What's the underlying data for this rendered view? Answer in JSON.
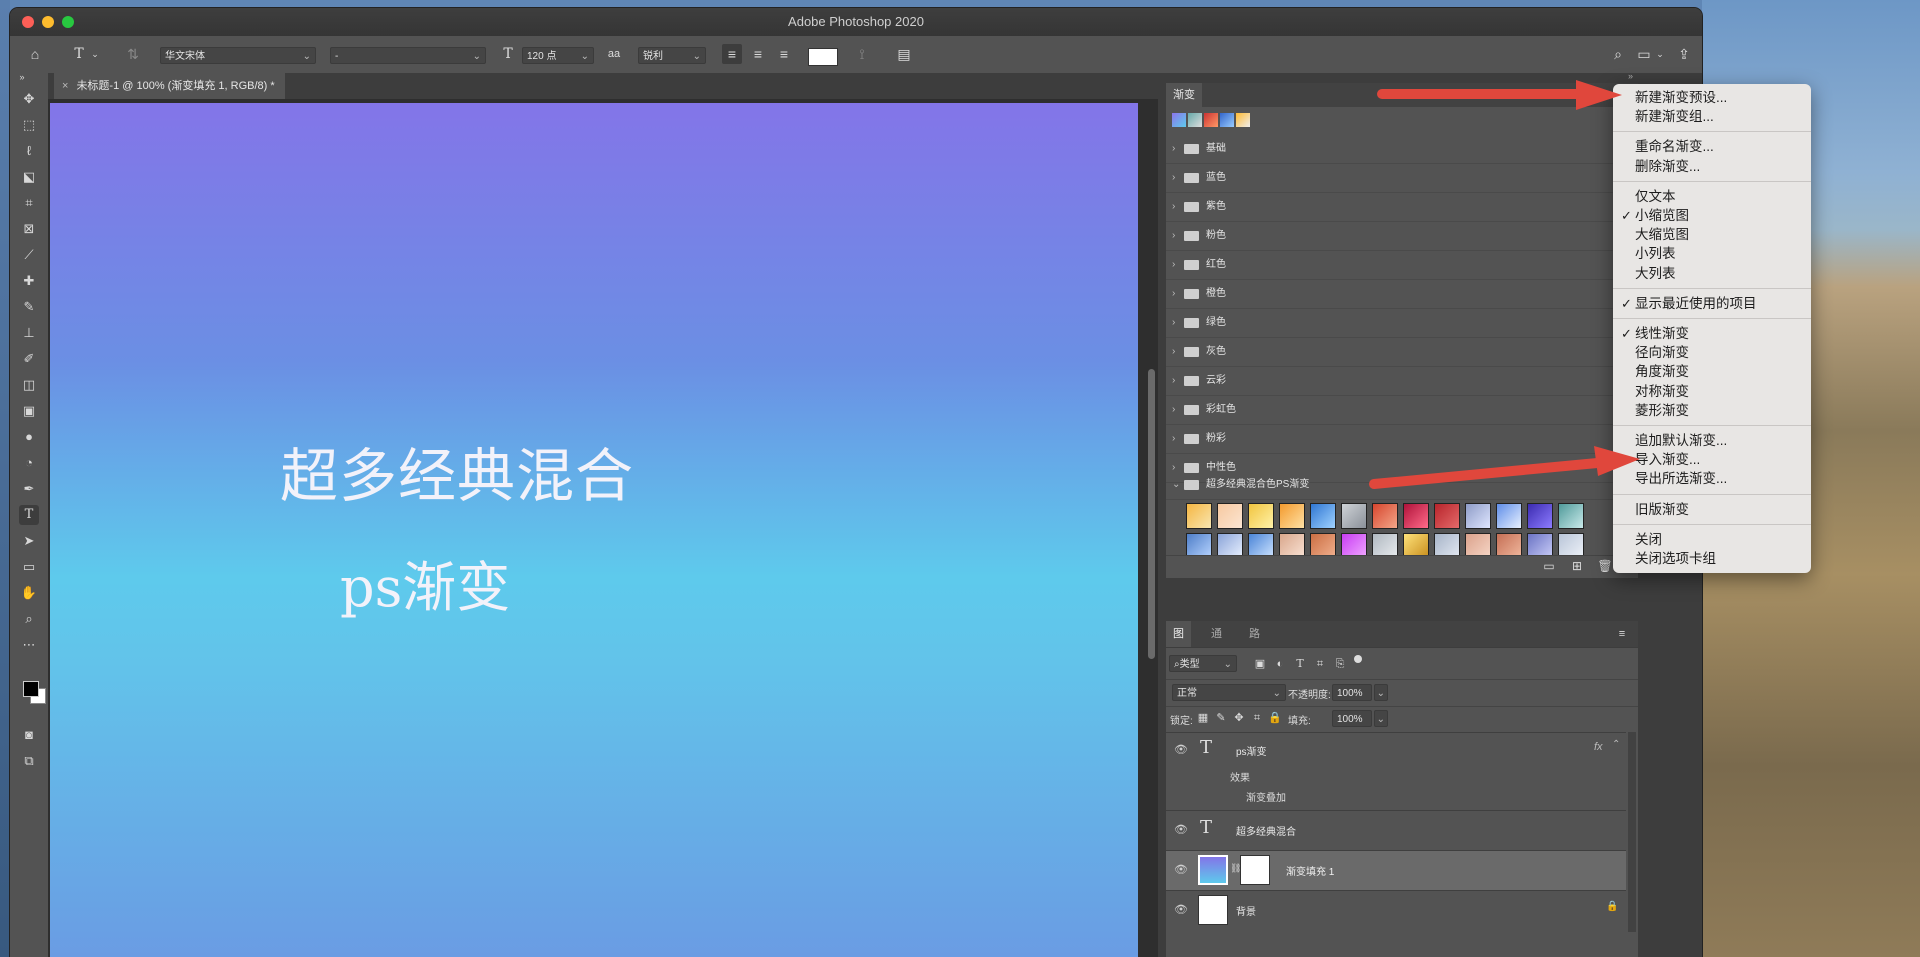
{
  "window": {
    "title": "Adobe Photoshop 2020"
  },
  "options_bar": {
    "font_family": "华文宋体",
    "font_style": "-",
    "font_size": "120 点",
    "antialias_icon": "aa",
    "antialias": "锐利"
  },
  "document": {
    "tab_title": "未标题-1 @ 100% (渐变填充 1, RGB/8) *",
    "close_glyph": "×",
    "canvas_text_1": "超多经典混合",
    "canvas_text_2": "ps渐变"
  },
  "gradients_panel": {
    "tab_label": "渐变",
    "folders": [
      "基础",
      "蓝色",
      "紫色",
      "粉色",
      "红色",
      "橙色",
      "绿色",
      "灰色",
      "云彩",
      "彩虹色",
      "粉彩",
      "中性色"
    ],
    "expanded_folder": "超多经典混合色PS渐变"
  },
  "layers_panel": {
    "tabs": [
      "图层",
      "通道",
      "路径"
    ],
    "filter_label": "类型",
    "blend_mode": "正常",
    "opacity_label": "不透明度:",
    "opacity_value": "100%",
    "lock_label": "锁定:",
    "fill_label": "填充:",
    "fill_value": "100%",
    "layers": [
      {
        "name": "ps渐变",
        "type": "text",
        "effects_label": "效果",
        "effect": "渐变叠加",
        "fx": "fx"
      },
      {
        "name": "超多经典混合",
        "type": "text"
      },
      {
        "name": "渐变填充 1",
        "type": "gradient-fill"
      },
      {
        "name": "背景",
        "type": "background"
      }
    ]
  },
  "context_menu": {
    "group1": [
      "新建渐变预设...",
      "新建渐变组..."
    ],
    "group2": [
      "重命名渐变...",
      "删除渐变..."
    ],
    "group3": [
      "仅文本",
      "小缩览图",
      "大缩览图",
      "小列表",
      "大列表"
    ],
    "group4": [
      "显示最近使用的项目"
    ],
    "group5": [
      "线性渐变",
      "径向渐变",
      "角度渐变",
      "对称渐变",
      "菱形渐变"
    ],
    "group6": [
      "追加默认渐变...",
      "导入渐变...",
      "导出所选渐变..."
    ],
    "group7": [
      "旧版渐变"
    ],
    "group8": [
      "关闭",
      "关闭选项卡组"
    ],
    "checkmark": "✓"
  },
  "colors": {
    "accent_arrow": "#e0473c",
    "menu_bg": "#e8e6e4",
    "ps_panel": "#535353"
  }
}
